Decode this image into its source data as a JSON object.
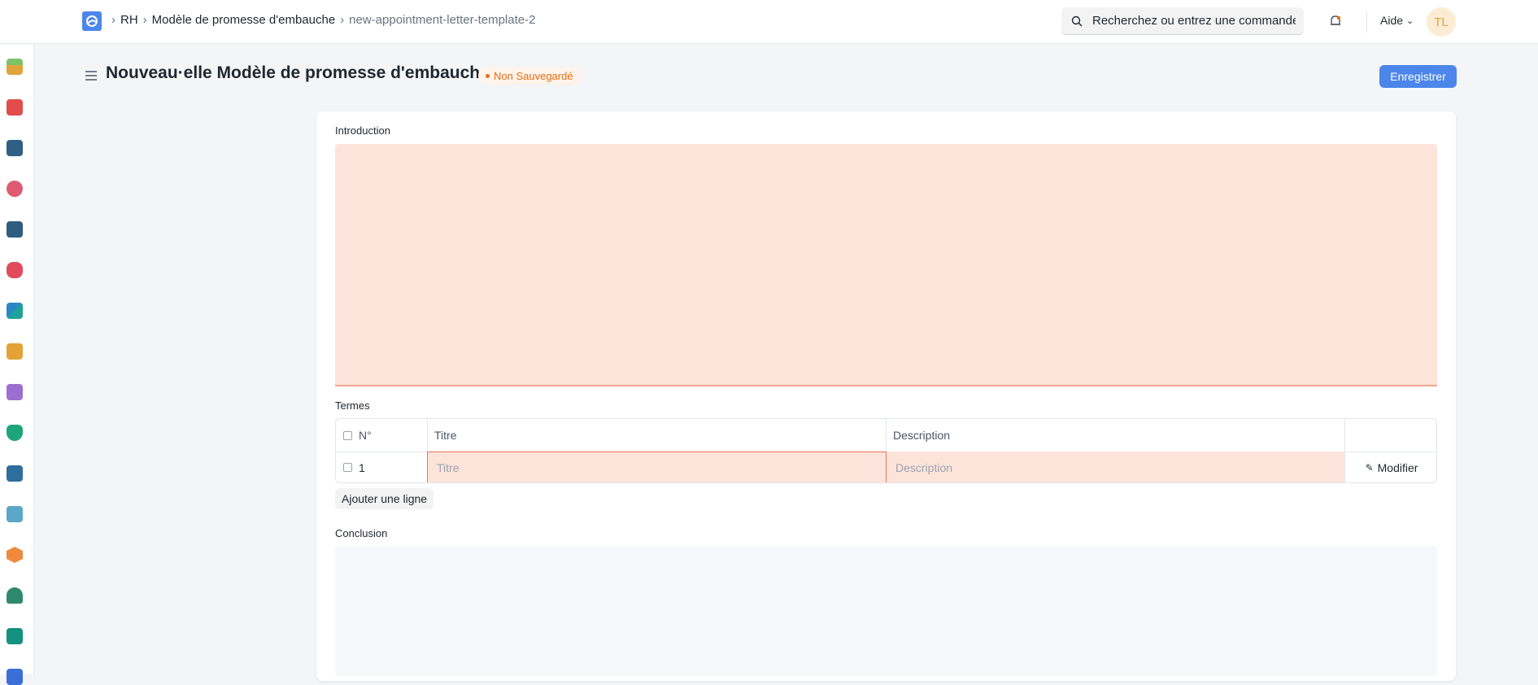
{
  "breadcrumb": {
    "items": [
      "RH",
      "Modèle de promesse d'embauche",
      "new-appointment-letter-template-2"
    ]
  },
  "search": {
    "placeholder": "Recherchez ou entrez une commande"
  },
  "help": {
    "label": "Aide"
  },
  "user": {
    "initials": "TL"
  },
  "page": {
    "title": "Nouveau·elle Modèle de promesse d'embauche",
    "status": "Non Sauvegardé",
    "save_label": "Enregistrer"
  },
  "form": {
    "introduction_label": "Introduction",
    "terms_label": "Termes",
    "conclusion_label": "Conclusion",
    "table": {
      "headers": {
        "no": "N°",
        "title": "Titre",
        "description": "Description"
      },
      "rows": [
        {
          "no": "1",
          "title_placeholder": "Titre",
          "description_placeholder": "Description",
          "edit_label": "Modifier"
        }
      ]
    },
    "add_row_label": "Ajouter une ligne"
  },
  "colors": {
    "accent": "#4c86ea",
    "warning_bg": "#fde4da",
    "status_orange": "#e86c13"
  },
  "sidebar_icons": [
    "plant-pot-icon",
    "camera-icon",
    "monitor-icon",
    "pie-chart-icon",
    "briefcase-icon",
    "heart-monitor-icon",
    "chat-icon",
    "building-icon",
    "folder-icon",
    "shield-icon",
    "toolbox-icon",
    "browser-window-icon",
    "hexagon-icon",
    "headset-icon",
    "credit-card-icon"
  ]
}
